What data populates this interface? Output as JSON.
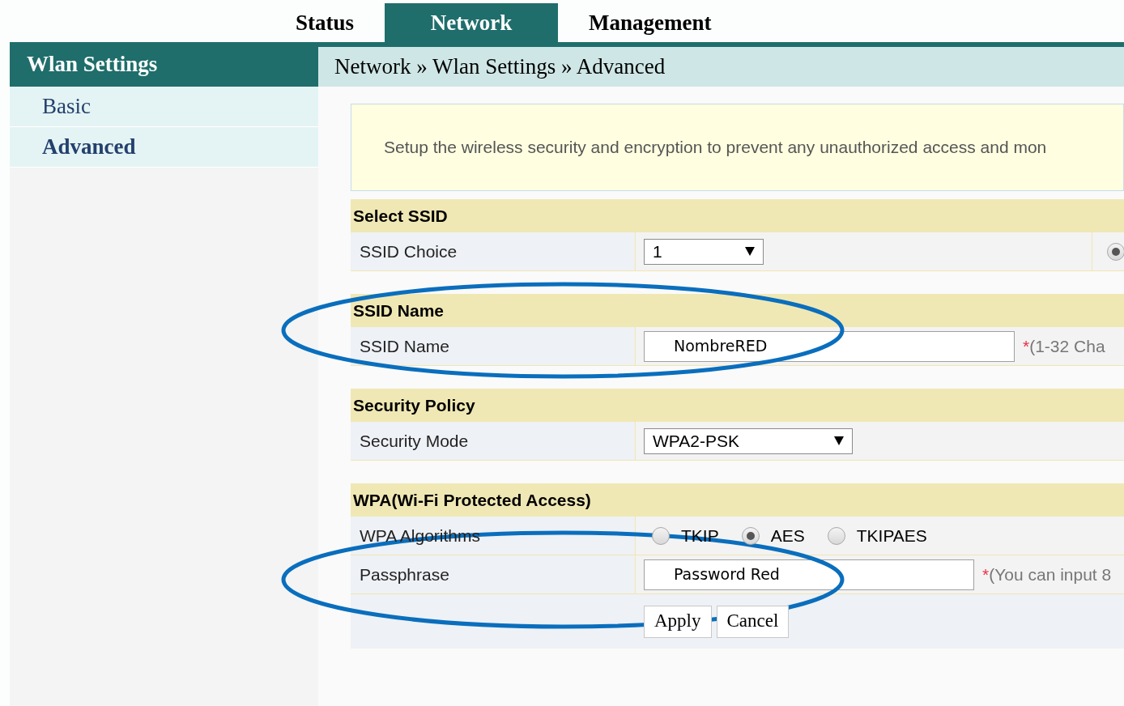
{
  "tabs": [
    {
      "label": "Status",
      "selected": false
    },
    {
      "label": "Network",
      "selected": true
    },
    {
      "label": "Management",
      "selected": false
    }
  ],
  "sidebar": {
    "title": "Wlan Settings",
    "items": [
      {
        "label": "Basic",
        "selected": false
      },
      {
        "label": "Advanced",
        "selected": true
      }
    ]
  },
  "breadcrumb": "Network » Wlan Settings » Advanced",
  "notice": "Setup the wireless security and encryption to prevent any unauthorized access and mon",
  "sections": [
    {
      "title": "Select SSID",
      "rows": [
        {
          "kind": "select",
          "label": "SSID Choice",
          "value": "1",
          "wide": false,
          "side_radio": {
            "selected": true
          }
        }
      ]
    },
    {
      "title": "SSID Name",
      "rows": [
        {
          "kind": "text",
          "label": "SSID Name",
          "value": "NombreRED",
          "wide": true,
          "mark": "*",
          "hint": "(1-32 Cha"
        }
      ]
    },
    {
      "title": "Security Policy",
      "rows": [
        {
          "kind": "select",
          "label": "Security Mode",
          "value": "WPA2-PSK",
          "wide": true
        }
      ]
    },
    {
      "title": "WPA(Wi-Fi Protected Access)",
      "rows": [
        {
          "kind": "radios",
          "label": "WPA Algorithms",
          "options": [
            {
              "label": "TKIP",
              "selected": false
            },
            {
              "label": "AES",
              "selected": true
            },
            {
              "label": "TKIPAES",
              "selected": false
            }
          ]
        },
        {
          "kind": "text",
          "label": "Passphrase",
          "value": "Password Red",
          "wide": false,
          "mark": "*",
          "hint": "(You can input 8"
        }
      ]
    }
  ],
  "buttons": [
    "Apply",
    "Cancel"
  ]
}
